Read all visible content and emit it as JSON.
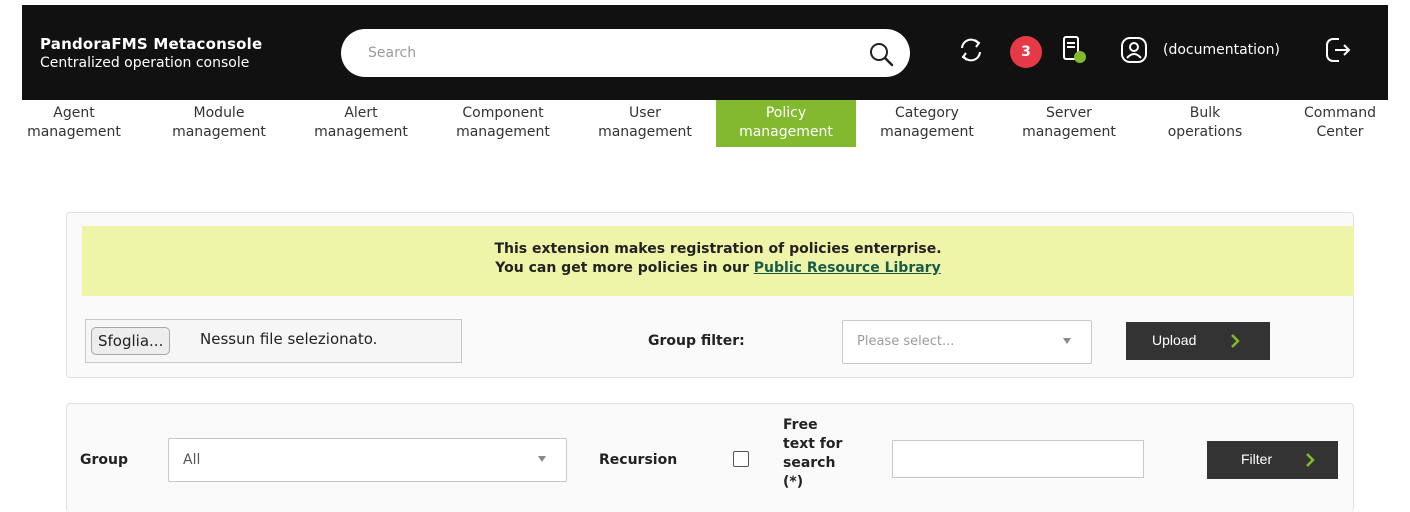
{
  "header": {
    "app_title": "PandoraFMS Metaconsole",
    "app_subtitle": "Centralized operation console",
    "search_placeholder": "Search",
    "notification_count": "3",
    "user_label": "(documentation)"
  },
  "nav": {
    "items": [
      {
        "line1": "Agent",
        "line2": "management"
      },
      {
        "line1": "Module",
        "line2": "management"
      },
      {
        "line1": "Alert",
        "line2": "management"
      },
      {
        "line1": "Component",
        "line2": "management"
      },
      {
        "line1": "User",
        "line2": "management"
      },
      {
        "line1": "Policy",
        "line2": "management"
      },
      {
        "line1": "Category",
        "line2": "management"
      },
      {
        "line1": "Server",
        "line2": "management"
      },
      {
        "line1": "Bulk",
        "line2": "operations"
      },
      {
        "line1": "Command",
        "line2": "Center"
      }
    ],
    "active_item": "Policy management"
  },
  "upload_panel": {
    "notice_line1": "This extension makes registration of policies enterprise.",
    "notice_line2_prefix": "You can get more policies in our ",
    "notice_link": "Public Resource Library",
    "file_button": "Sfoglia...",
    "file_status": "Nessun file selezionato.",
    "group_filter_label": "Group filter:",
    "group_filter_placeholder": "Please select...",
    "upload_button": "Upload"
  },
  "filter_panel": {
    "group_label": "Group",
    "group_value": "All",
    "recursion_label": "Recursion",
    "recursion_checked": false,
    "free_text_label_lines": [
      "Free",
      "text for",
      "search",
      "(*)"
    ],
    "free_text_value": "",
    "filter_button": "Filter"
  },
  "colors": {
    "header_bg": "#111111",
    "active_tab": "#82b92e",
    "notice_bg": "#eff5a8",
    "badge": "#e63946",
    "button_bg": "#333333",
    "chevron": "#82b92e"
  }
}
